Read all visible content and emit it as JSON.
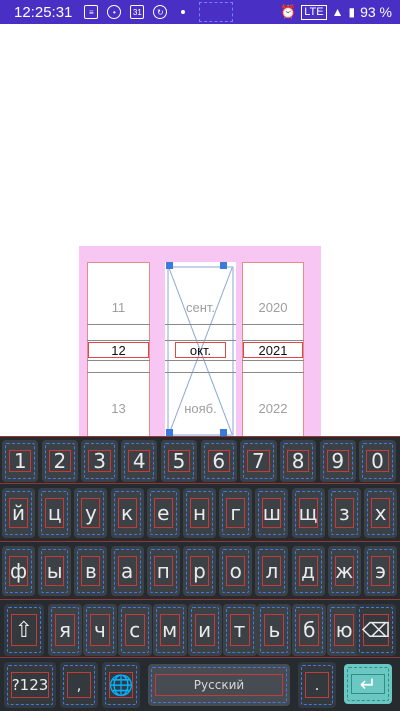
{
  "status_bar": {
    "time": "12:25:31",
    "calendar_day": "31",
    "network": "LTE",
    "battery": "93 %",
    "icons": [
      "notes-icon",
      "record-icon",
      "calendar-icon",
      "sync-icon",
      "dot-icon",
      "alarm-icon",
      "signal-icon",
      "battery-icon"
    ]
  },
  "date_picker": {
    "day": {
      "prev": "11",
      "current": "12",
      "next": "13"
    },
    "month": {
      "prev": "сент.",
      "current": "окт.",
      "next": "нояб."
    },
    "year": {
      "prev": "2020",
      "current": "2021",
      "next": "2022"
    },
    "background_color": "#f7c6f3"
  },
  "keyboard": {
    "numbers": [
      "1",
      "2",
      "3",
      "4",
      "5",
      "6",
      "7",
      "8",
      "9",
      "0"
    ],
    "row1": [
      "й",
      "ц",
      "у",
      "к",
      "е",
      "н",
      "г",
      "ш",
      "щ",
      "з",
      "х"
    ],
    "row2": [
      "ф",
      "ы",
      "в",
      "а",
      "п",
      "р",
      "о",
      "л",
      "д",
      "ж",
      "э"
    ],
    "row3": [
      "я",
      "ч",
      "с",
      "м",
      "и",
      "т",
      "ь",
      "б",
      "ю"
    ],
    "symbols_label": "?123",
    "comma_label": ",",
    "space_label": "Русский",
    "period_label": ".",
    "enter_color": "#6bc7c1",
    "background_color": "#262b30"
  }
}
